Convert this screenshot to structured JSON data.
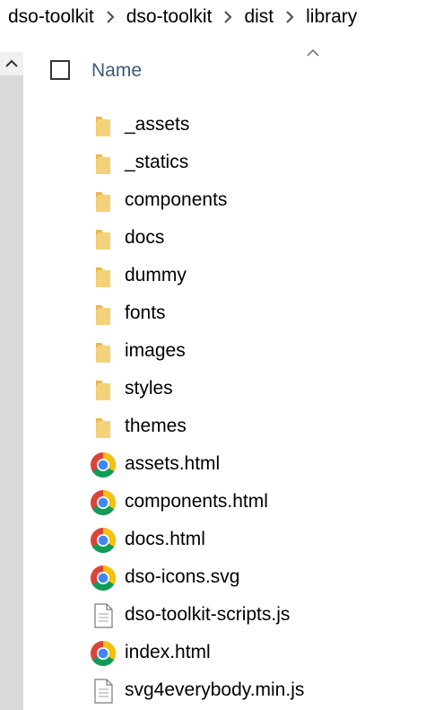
{
  "breadcrumb": {
    "items": [
      "dso-toolkit",
      "dso-toolkit",
      "dist",
      "library"
    ]
  },
  "header": {
    "name_column": "Name"
  },
  "files": [
    {
      "name": "_assets",
      "type": "folder"
    },
    {
      "name": "_statics",
      "type": "folder"
    },
    {
      "name": "components",
      "type": "folder"
    },
    {
      "name": "docs",
      "type": "folder"
    },
    {
      "name": "dummy",
      "type": "folder"
    },
    {
      "name": "fonts",
      "type": "folder"
    },
    {
      "name": "images",
      "type": "folder"
    },
    {
      "name": "styles",
      "type": "folder"
    },
    {
      "name": "themes",
      "type": "folder"
    },
    {
      "name": "assets.html",
      "type": "chrome"
    },
    {
      "name": "components.html",
      "type": "chrome"
    },
    {
      "name": "docs.html",
      "type": "chrome"
    },
    {
      "name": "dso-icons.svg",
      "type": "chrome"
    },
    {
      "name": "dso-toolkit-scripts.js",
      "type": "document"
    },
    {
      "name": "index.html",
      "type": "chrome"
    },
    {
      "name": "svg4everybody.min.js",
      "type": "document"
    }
  ],
  "icons": {
    "folder": "folder-icon",
    "chrome": "chrome-icon",
    "document": "document-icon",
    "chevron": "chevron-right-icon",
    "sort": "sort-up-icon",
    "scroll_up": "scroll-up-icon"
  },
  "colors": {
    "folder": "#f5d27a",
    "folder_dark": "#e8b84a",
    "chrome_red": "#db4437",
    "chrome_yellow": "#f4c20d",
    "chrome_green": "#0f9d58",
    "chrome_blue": "#4285f4",
    "header_text": "#3c5a7c"
  }
}
